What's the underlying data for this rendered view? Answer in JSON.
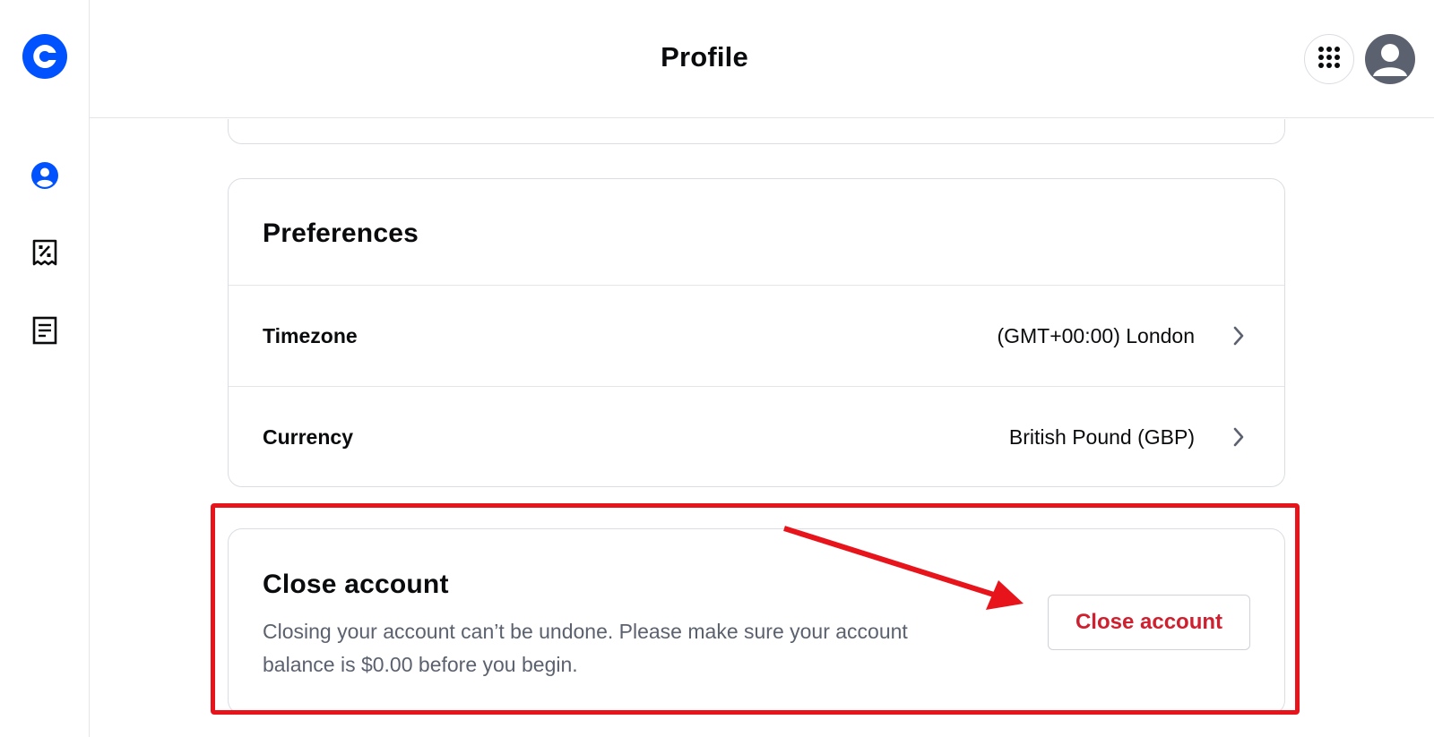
{
  "header": {
    "title": "Profile",
    "apps_icon": "grid-dots-icon",
    "avatar_icon": "user-avatar-icon"
  },
  "sidebar": {
    "logo_icon": "coinbase-logo",
    "items": [
      {
        "name": "profile",
        "icon": "user-circle-icon",
        "active": true
      },
      {
        "name": "offers",
        "icon": "receipt-percent-icon",
        "active": false
      },
      {
        "name": "documents",
        "icon": "document-icon",
        "active": false
      }
    ]
  },
  "preferences": {
    "title": "Preferences",
    "rows": [
      {
        "label": "Timezone",
        "value": "(GMT+00:00) London"
      },
      {
        "label": "Currency",
        "value": "British Pound (GBP)"
      }
    ]
  },
  "close_account": {
    "title": "Close account",
    "description": "Closing your account can’t be undone. Please make sure your account balance is $0.00 before you begin.",
    "button_label": "Close account"
  },
  "colors": {
    "brand_blue": "#0052ff",
    "danger_red": "#cf202f",
    "annotation_red": "#e8141c",
    "muted_text": "#5b616e"
  }
}
